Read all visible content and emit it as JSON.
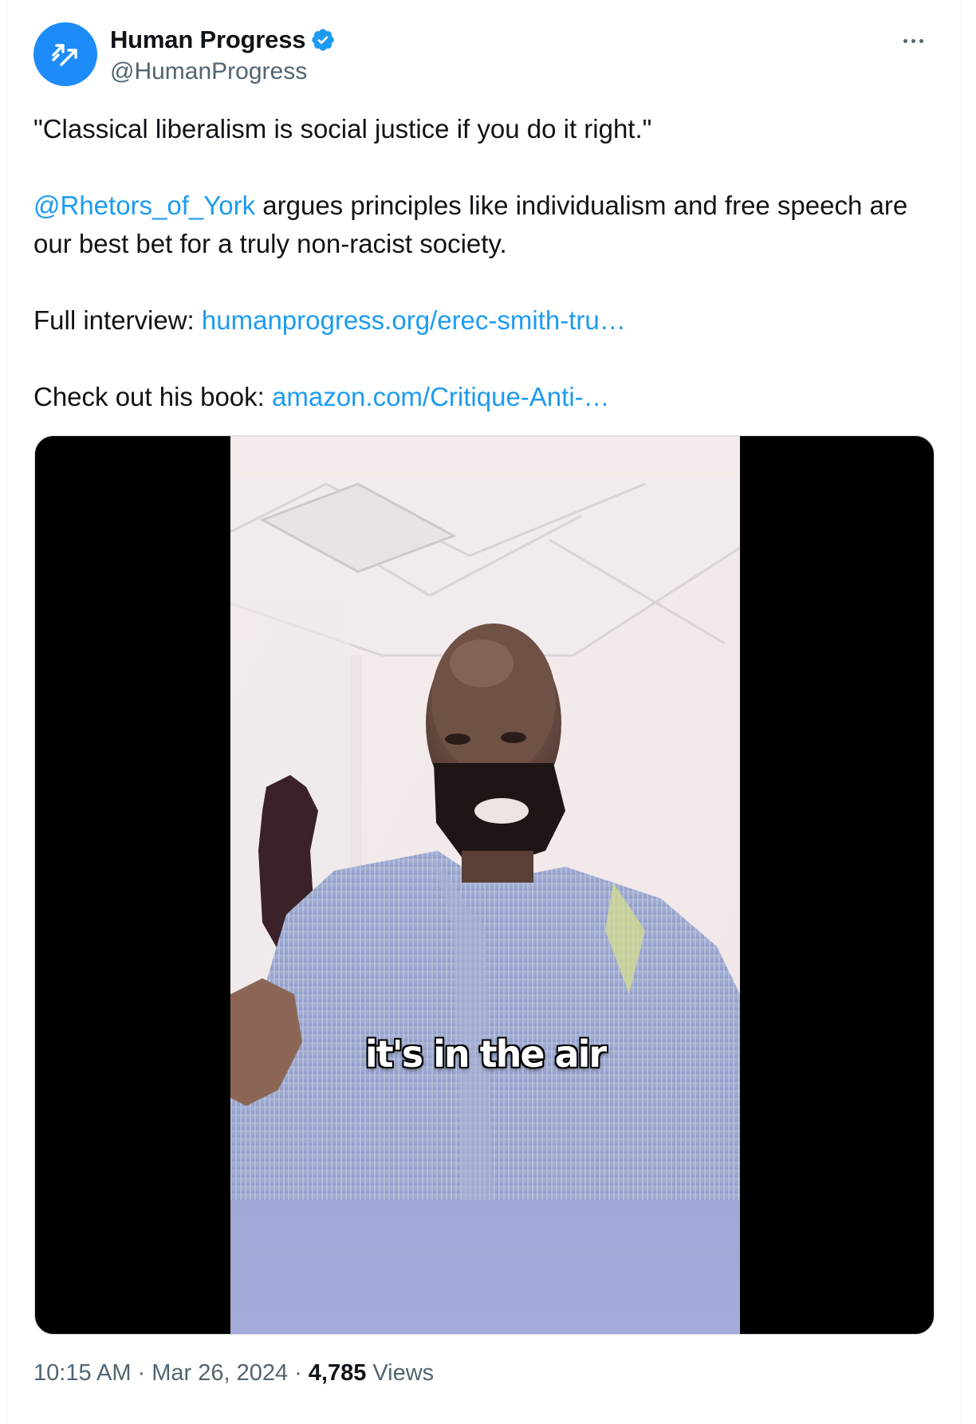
{
  "author": {
    "display_name": "Human Progress",
    "handle": "@HumanProgress",
    "avatar_icon": "trending-arrows-icon",
    "avatar_color": "#1d8cf8",
    "verified": true
  },
  "tweet": {
    "quote": "\"Classical liberalism is social justice if you do it right.\"",
    "mention": "@Rhetors_of_York",
    "body_after_mention": " argues principles like individualism and free speech are our best bet for a truly non-racist society.",
    "interview_label": "Full interview: ",
    "interview_link": "humanprogress.org/erec-smith-tru…",
    "book_label": "Check out his book: ",
    "book_link": "amazon.com/Critique-Anti-…"
  },
  "media": {
    "caption": "it's in the air"
  },
  "meta": {
    "time": "10:15 AM",
    "separator": "·",
    "date": "Mar 26, 2024",
    "views_count": "4,785",
    "views_label": "Views"
  },
  "colors": {
    "link": "#1d9bf0",
    "secondary_text": "#536471",
    "primary_text": "#0f1419",
    "verified_badge": "#1d9bf0"
  }
}
